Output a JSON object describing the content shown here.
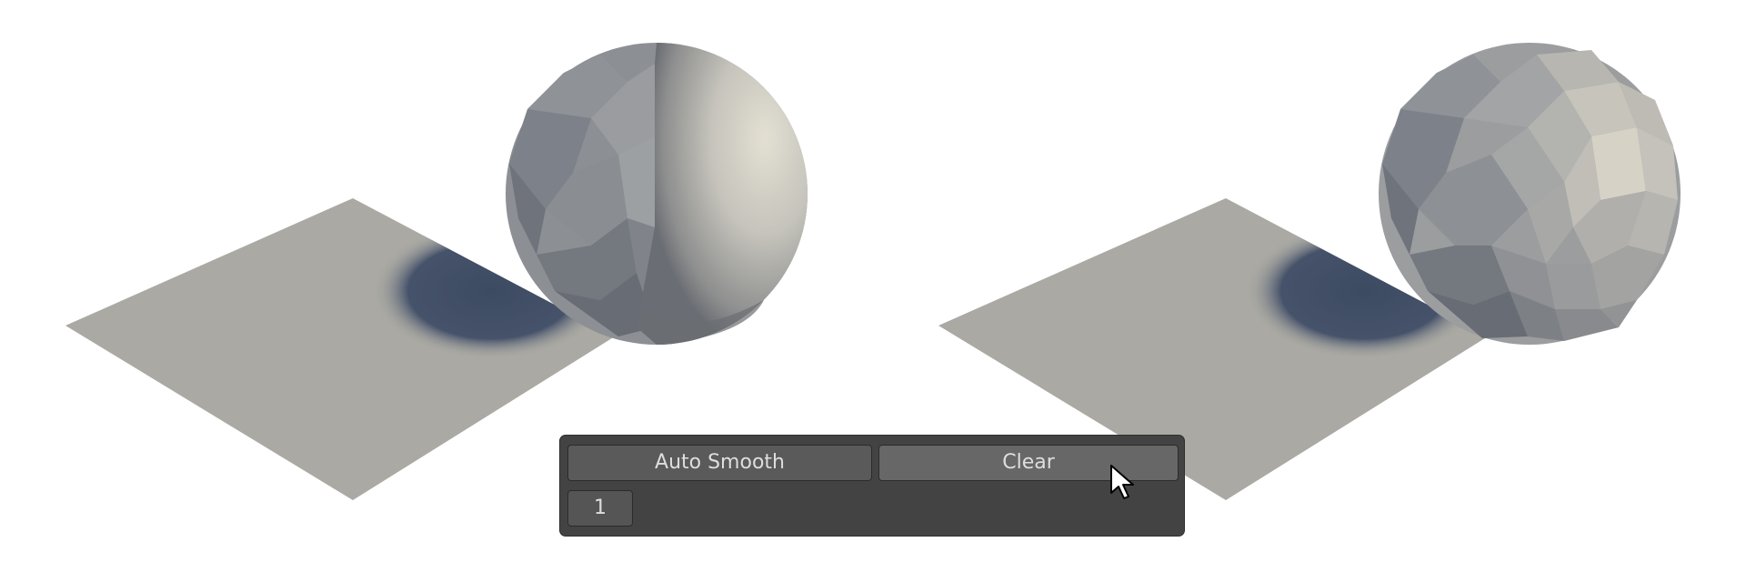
{
  "scene": {
    "left_viewport": {
      "sphere_shading": "partially-smoothed"
    },
    "right_viewport": {
      "sphere_shading": "flat"
    }
  },
  "toolbar": {
    "auto_smooth_label": "Auto Smooth",
    "clear_label": "Clear",
    "count_value": "1"
  },
  "icons": {
    "cursor": "mouse-pointer-icon"
  },
  "colors": {
    "panel_background": "#434343",
    "button_background": "#5a5a5a",
    "button_hover_background": "#676767",
    "button_text": "#dedede",
    "plane": "#aaa9a3",
    "shadow": "#415068",
    "sphere_light": "#d9d6cb",
    "sphere_dark": "#5e6168"
  }
}
